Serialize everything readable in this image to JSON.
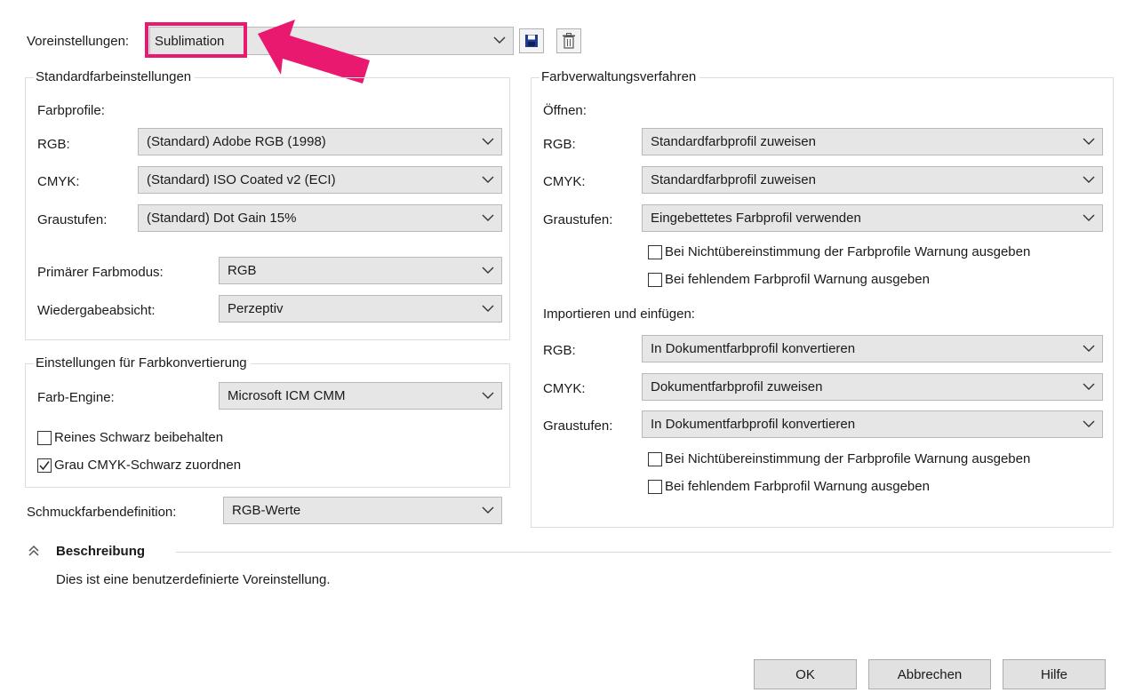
{
  "preset": {
    "label": "Voreinstellungen:",
    "value": "Sublimation",
    "save_icon": "save-icon",
    "delete_icon": "trash-icon"
  },
  "standard": {
    "title": "Standardfarbeinstellungen",
    "profiles_label": "Farbprofile:",
    "rgb_label": "RGB:",
    "rgb_value": "(Standard) Adobe RGB (1998)",
    "cmyk_label": "CMYK:",
    "cmyk_value": "(Standard) ISO Coated v2 (ECI)",
    "gray_label": "Graustufen:",
    "gray_value": "(Standard) Dot Gain 15%",
    "primary_mode_label": "Primärer Farbmodus:",
    "primary_mode_value": "RGB",
    "intent_label": "Wiedergabeabsicht:",
    "intent_value": "Perzeptiv"
  },
  "conversion": {
    "title": "Einstellungen für Farbkonvertierung",
    "engine_label": "Farb-Engine:",
    "engine_value": "Microsoft ICM CMM",
    "pure_black_label": "Reines Schwarz beibehalten",
    "pure_black_checked": false,
    "gray_cmyk_label": "Grau CMYK-Schwarz zuordnen",
    "gray_cmyk_checked": true
  },
  "spot": {
    "label": "Schmuckfarbendefinition:",
    "value": "RGB-Werte"
  },
  "management": {
    "title": "Farbverwaltungsverfahren",
    "open_label": "Öffnen:",
    "open_rgb_label": "RGB:",
    "open_rgb_value": "Standardfarbprofil zuweisen",
    "open_cmyk_label": "CMYK:",
    "open_cmyk_value": "Standardfarbprofil zuweisen",
    "open_gray_label": "Graustufen:",
    "open_gray_value": "Eingebettetes Farbprofil verwenden",
    "open_mismatch_label": "Bei Nichtübereinstimmung der Farbprofile Warnung ausgeben",
    "open_missing_label": "Bei fehlendem Farbprofil Warnung ausgeben",
    "import_label": "Importieren und einfügen:",
    "import_rgb_label": "RGB:",
    "import_rgb_value": "In Dokumentfarbprofil konvertieren",
    "import_cmyk_label": "CMYK:",
    "import_cmyk_value": "Dokumentfarbprofil zuweisen",
    "import_gray_label": "Graustufen:",
    "import_gray_value": "In Dokumentfarbprofil konvertieren",
    "import_mismatch_label": "Bei Nichtübereinstimmung der Farbprofile Warnung ausgeben",
    "import_missing_label": "Bei fehlendem Farbprofil Warnung ausgeben"
  },
  "description": {
    "title": "Beschreibung",
    "text": "Dies ist eine benutzerdefinierte Voreinstellung.",
    "toggle_icon": "chevron-double-up-icon"
  },
  "buttons": {
    "ok": "OK",
    "cancel": "Abbrechen",
    "help": "Hilfe"
  },
  "annotation": {
    "highlight_color": "#e8196e",
    "arrow_color": "#e8196e"
  }
}
